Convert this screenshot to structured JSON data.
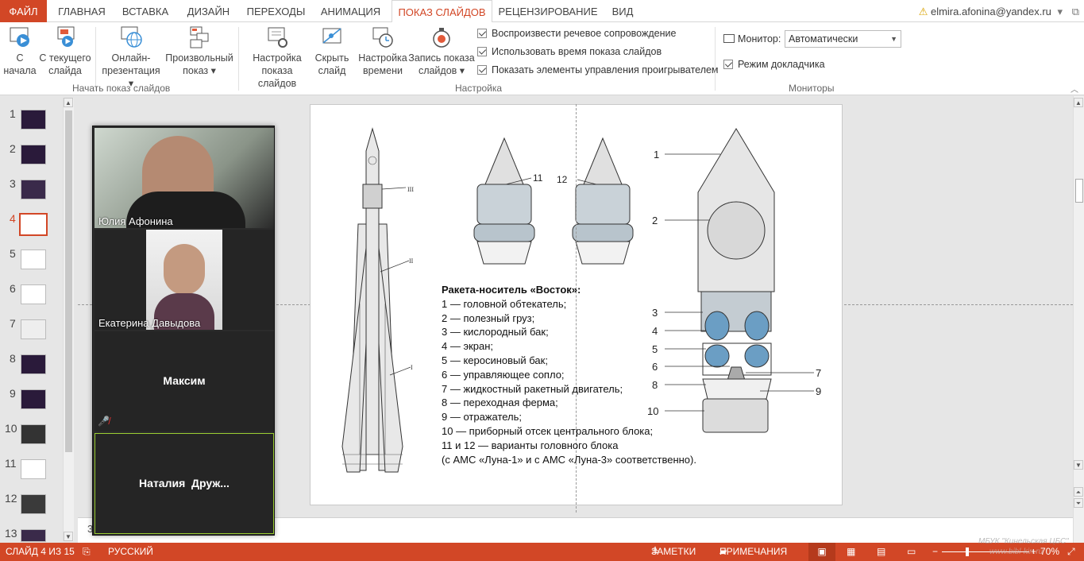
{
  "tabs": {
    "file": "ФАЙЛ",
    "home": "ГЛАВНАЯ",
    "insert": "ВСТАВКА",
    "design": "ДИЗАЙН",
    "transitions": "ПЕРЕХОДЫ",
    "animation": "АНИМАЦИЯ",
    "slideshow": "ПОКАЗ СЛАЙДОВ",
    "review": "РЕЦЕНЗИРОВАНИЕ",
    "view": "ВИД"
  },
  "account": {
    "email": "elmira.afonina@yandex.ru"
  },
  "ribbon": {
    "from_start_1": "С",
    "from_start_2": "начала",
    "from_current_1": "С текущего",
    "from_current_2": "слайда",
    "online_1": "Онлайн-",
    "online_2": "презентация ▾",
    "custom_1": "Произвольный",
    "custom_2": "показ ▾",
    "group_start": "Начать показ слайдов",
    "setup_1": "Настройка",
    "setup_2": "показа слайдов",
    "hide_1": "Скрыть",
    "hide_2": "слайд",
    "rehearse_1": "Настройка",
    "rehearse_2": "времени",
    "record_1": "Запись показа",
    "record_2": "слайдов ▾",
    "chk_narration": "Воспроизвести речевое сопровождение",
    "chk_timings": "Использовать время показа слайдов",
    "chk_controls": "Показать элементы управления проигрывателем",
    "group_setup": "Настройка",
    "monitor_label": "Монитор:",
    "monitor_value": "Автоматически",
    "chk_presenter": "Режим докладчика",
    "group_monitors": "Мониторы"
  },
  "thumbs": [
    "1",
    "2",
    "3",
    "4",
    "5",
    "6",
    "7",
    "8",
    "9",
    "10",
    "11",
    "12",
    "13"
  ],
  "active_slide": 4,
  "video": {
    "p1": "Юлия Афонина",
    "p2": "Екатерина Давыдова",
    "p3": "Максим",
    "p4": "Наталия  Друж..."
  },
  "slide": {
    "caption_title": "Ракета-носитель «Восток»:",
    "caption_lines": "1 — головной обтекатель;\n2 — полезный груз;\n3 — кислородный бак;\n4 — экран;\n5 — керосиновый бак;\n6 — управляющее сопло;\n7 — жидкостный ракетный двигатель;\n8 — переходная ферма;\n9 — отражатель;\n10 — приборный отсек центрального блока;\n11 и 12 — варианты головного блока\n(с АМС «Луна-1» и с АМС «Луна-3» соответственно).",
    "lbl_3": "III",
    "lbl_2": "II",
    "lbl_1": "I",
    "lbl_11": "11",
    "lbl_12": "12",
    "n1": "1",
    "n2": "2",
    "n3": "3",
    "n4": "4",
    "n5": "5",
    "n6": "6",
    "n7": "7",
    "n8": "8",
    "n9": "9",
    "n10": "10"
  },
  "notes_num": "3",
  "status": {
    "slide": "СЛАЙД 4 ИЗ 15",
    "lang": "РУССКИЙ",
    "notes": "ЗАМЕТКИ",
    "comments": "ПРИМЕЧАНИЯ",
    "zoom": "70%",
    "watermark": "МБУК \"Кинельская ЦБС\"",
    "watermark2": "www.bibl-kin.ru"
  }
}
